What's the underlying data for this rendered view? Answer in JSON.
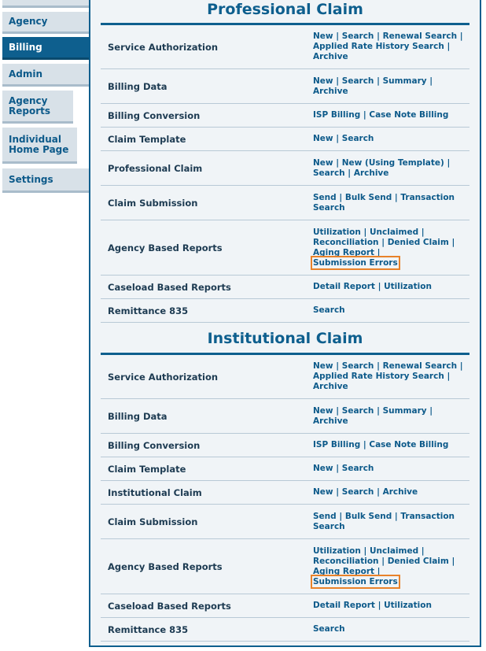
{
  "sidebar": {
    "items": [
      {
        "label": "Agency",
        "active": false
      },
      {
        "label": "Billing",
        "active": true
      },
      {
        "label": "Admin",
        "active": false
      },
      {
        "label": "Agency Reports",
        "active": false
      },
      {
        "label": "Individual Home Page",
        "active": false
      },
      {
        "label": "Settings",
        "active": false
      }
    ]
  },
  "sections": [
    {
      "title": "Professional Claim",
      "rows": [
        {
          "label": "Service Authorization",
          "links": [
            "New",
            "Search",
            "Renewal Search",
            "Applied Rate History Search",
            "Archive"
          ]
        },
        {
          "label": "Billing Data",
          "links": [
            "New",
            "Search",
            "Summary",
            "Archive"
          ]
        },
        {
          "label": "Billing Conversion",
          "links": [
            "ISP Billing",
            "Case Note Billing"
          ]
        },
        {
          "label": "Claim Template",
          "links": [
            "New",
            "Search"
          ]
        },
        {
          "label": "Professional Claim",
          "links": [
            "New",
            "New (Using Template)",
            "Search",
            "Archive"
          ]
        },
        {
          "label": "Claim Submission",
          "links": [
            "Send",
            "Bulk Send",
            "Transaction Search"
          ]
        },
        {
          "label": "Agency Based Reports",
          "links": [
            "Utilization",
            "Unclaimed",
            "Reconciliation",
            "Denied Claim",
            "Aging Report",
            "Submission Errors"
          ],
          "highlighted": "Submission Errors"
        },
        {
          "label": "Caseload Based Reports",
          "links": [
            "Detail Report",
            "Utilization"
          ]
        },
        {
          "label": "Remittance 835",
          "links": [
            "Search"
          ]
        }
      ]
    },
    {
      "title": "Institutional Claim",
      "rows": [
        {
          "label": "Service Authorization",
          "links": [
            "New",
            "Search",
            "Renewal Search",
            "Applied Rate History Search",
            "Archive"
          ]
        },
        {
          "label": "Billing Data",
          "links": [
            "New",
            "Search",
            "Summary",
            "Archive"
          ]
        },
        {
          "label": "Billing Conversion",
          "links": [
            "ISP Billing",
            "Case Note Billing"
          ]
        },
        {
          "label": "Claim Template",
          "links": [
            "New",
            "Search"
          ]
        },
        {
          "label": "Institutional Claim",
          "links": [
            "New",
            "Search",
            "Archive"
          ]
        },
        {
          "label": "Claim Submission",
          "links": [
            "Send",
            "Bulk Send",
            "Transaction Search"
          ]
        },
        {
          "label": "Agency Based Reports",
          "links": [
            "Utilization",
            "Unclaimed",
            "Reconciliation",
            "Denied Claim",
            "Aging Report",
            "Submission Errors"
          ],
          "highlighted": "Submission Errors"
        },
        {
          "label": "Caseload Based Reports",
          "links": [
            "Detail Report",
            "Utilization"
          ]
        },
        {
          "label": "Remittance 835",
          "links": [
            "Search"
          ]
        }
      ]
    }
  ],
  "colors": {
    "accent": "#0e5f8e",
    "highlight": "#e8822a",
    "panel": "#f0f4f7"
  }
}
